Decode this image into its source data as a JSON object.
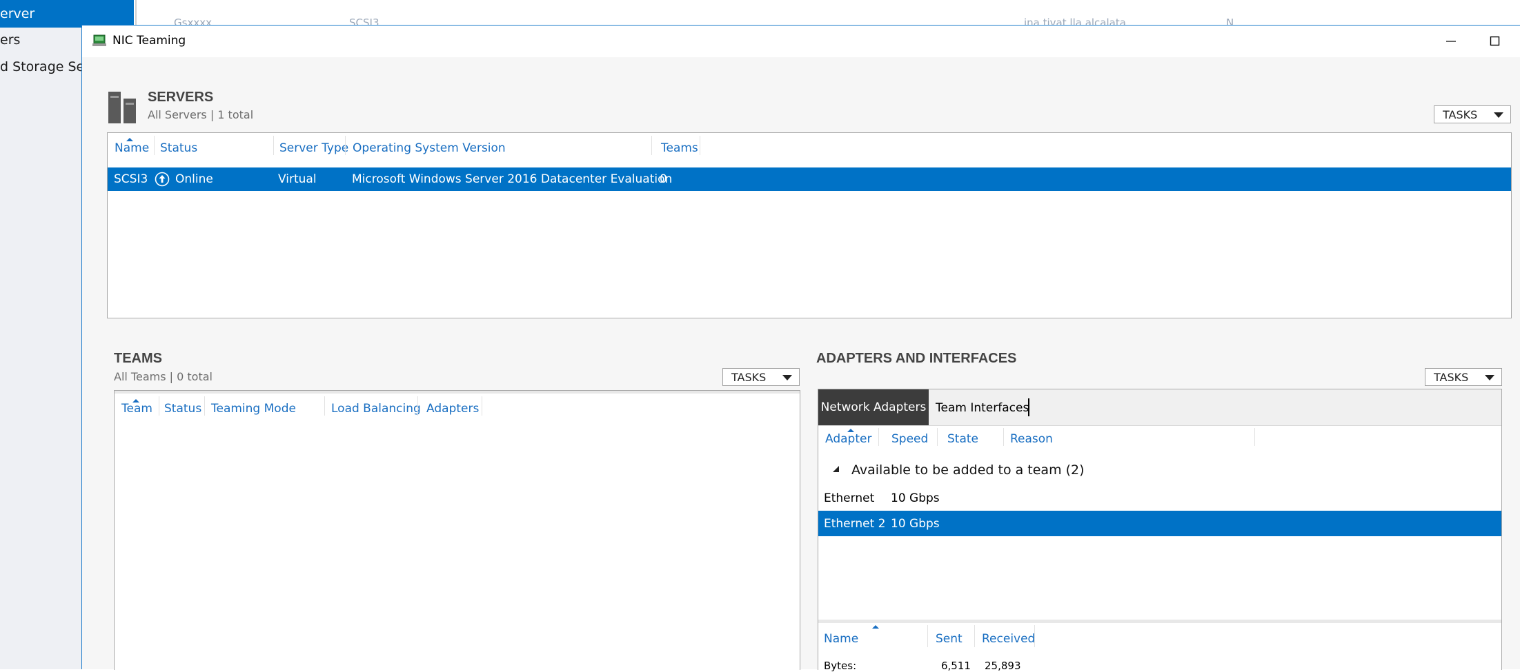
{
  "background": {
    "sidebar_selected": "erver",
    "sidebar_items": [
      "ers",
      "d Storage Ser"
    ],
    "faint_text": [
      "Gsxxxx",
      "SCSI3",
      "ina tivat lla alcalata",
      "N"
    ]
  },
  "dialog": {
    "title": "NIC Teaming",
    "minimize_glyph": "—",
    "maximize_glyph": "☐"
  },
  "servers": {
    "title": "SERVERS",
    "subtitle": "All Servers | 1 total",
    "tasks_label": "TASKS",
    "columns": [
      "Name",
      "Status",
      "Server Type",
      "Operating System Version",
      "Teams"
    ],
    "rows": [
      {
        "name": "SCSI3",
        "status": "Online",
        "server_type": "Virtual",
        "os": "Microsoft Windows Server 2016 Datacenter Evaluation",
        "teams": "0"
      }
    ]
  },
  "teams": {
    "title": "TEAMS",
    "subtitle": "All Teams | 0 total",
    "tasks_label": "TASKS",
    "columns": [
      "Team",
      "Status",
      "Teaming Mode",
      "Load Balancing",
      "Adapters"
    ]
  },
  "adapters": {
    "title": "ADAPTERS AND INTERFACES",
    "tasks_label": "TASKS",
    "tabs": [
      "Network Adapters",
      "Team Interfaces"
    ],
    "columns": [
      "Adapter",
      "Speed",
      "State",
      "Reason"
    ],
    "group_label": "Available to be added to a team (2)",
    "rows": [
      {
        "adapter": "Ethernet",
        "speed": "10 Gbps"
      },
      {
        "adapter": "Ethernet 2",
        "speed": "10 Gbps"
      }
    ],
    "stats_columns": [
      "Name",
      "Sent",
      "Received"
    ],
    "stats_rows": [
      {
        "name": "Bytes:",
        "sent": "6,511",
        "received": "25,893"
      }
    ]
  },
  "colors": {
    "selection": "#0072c6",
    "header_text": "#1a6fc2",
    "tab_active": "#3c3c3c"
  }
}
